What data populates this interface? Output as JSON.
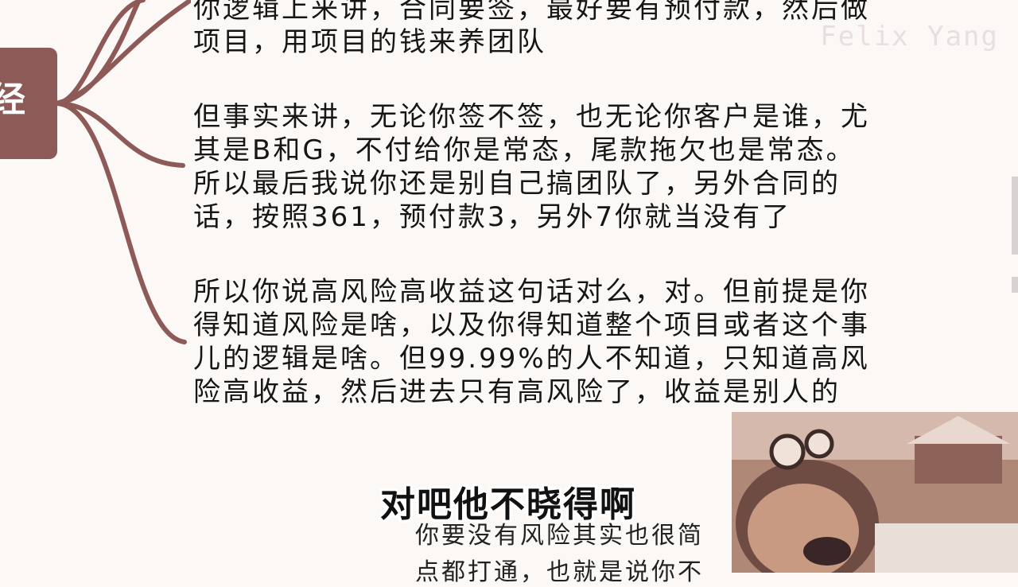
{
  "mindmap": {
    "node_char": "经"
  },
  "watermark": "Felix Yang",
  "paragraphs": [
    "你逻辑上来讲，合同要签，最好要有预付款，然后做\n项目，用项目的钱来养团队",
    "但事实来讲，无论你签不签，也无论你客户是谁，尤\n其是B和G，不付给你是常态，尾款拖欠也是常态。\n所以最后我说你还是别自己搞团队了，另外合同的\n话，按照361，预付款3，另外7你就当没有了",
    "所以你说高风险高收益这句话对么，对。但前提是你\n得知道风险是啥，以及你得知道整个项目或者这个事\n儿的逻辑是啥。但99.99%的人不知道，只知道高风\n险高收益，然后进去只有高风险了，收益是别人的"
  ],
  "partial_lines": [
    "你要没有风险其实也很简",
    "点都打通，也就是说你不"
  ],
  "subtitle": "对吧他不晓得啊",
  "colors": {
    "branch": "#8e5a58",
    "background": "#fbf8f6",
    "text": "#161616"
  }
}
